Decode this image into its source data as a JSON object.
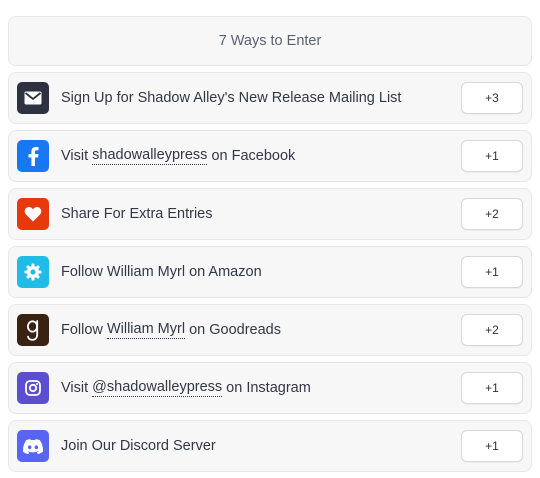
{
  "header": {
    "title": "7 Ways to Enter"
  },
  "entries": [
    {
      "icon": "email-icon",
      "icon_color": "#2d3140",
      "label_parts": [
        "Sign Up for Shadow Alley's New Release Mailing List"
      ],
      "points": "+3"
    },
    {
      "icon": "facebook-icon",
      "icon_color": "#1877f2",
      "label_parts": [
        "Visit ",
        "shadowalleypress",
        " on Facebook"
      ],
      "points": "+1"
    },
    {
      "icon": "heart-icon",
      "icon_color": "#e8380d",
      "label_parts": [
        "Share For Extra Entries"
      ],
      "points": "+2"
    },
    {
      "icon": "gear-icon",
      "icon_color": "#1fbce8",
      "label_parts": [
        "Follow William Myrl on Amazon"
      ],
      "points": "+1"
    },
    {
      "icon": "goodreads-icon",
      "icon_color": "#3a2212",
      "label_parts": [
        "Follow ",
        "William Myrl",
        " on Goodreads"
      ],
      "points": "+2"
    },
    {
      "icon": "instagram-icon",
      "icon_color": "#5b4fcf",
      "label_parts": [
        "Visit ",
        "@shadowalleypress",
        " on Instagram"
      ],
      "points": "+1"
    },
    {
      "icon": "discord-icon",
      "icon_color": "#5865f2",
      "label_parts": [
        "Join Our Discord Server"
      ],
      "points": "+1"
    }
  ]
}
